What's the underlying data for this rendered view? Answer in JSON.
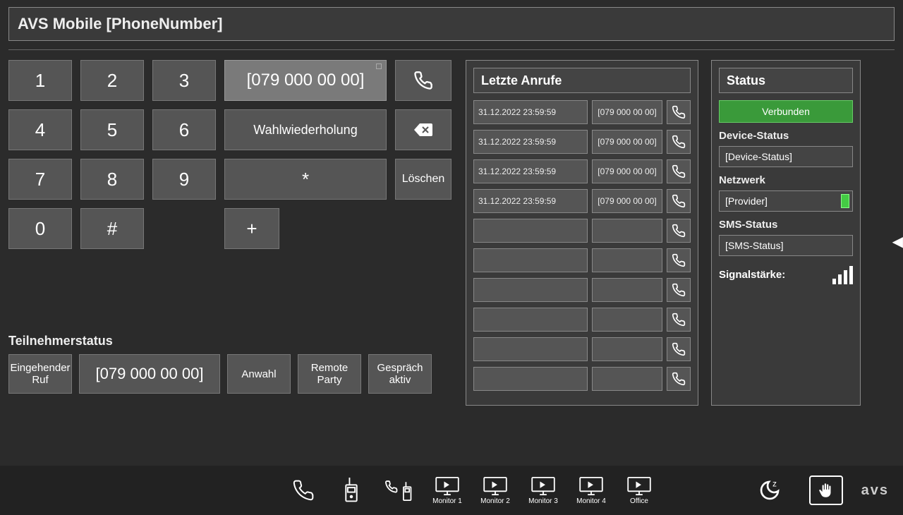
{
  "title": "AVS Mobile [PhoneNumber]",
  "dial": {
    "display": "[079 000 00 00]",
    "redial": "Wahlwiederholung",
    "clear": "Löschen",
    "keys": {
      "1": "1",
      "2": "2",
      "3": "3",
      "4": "4",
      "5": "5",
      "6": "6",
      "7": "7",
      "8": "8",
      "9": "9",
      "star": "*",
      "0": "0",
      "hash": "#",
      "plus": "+"
    }
  },
  "participant": {
    "label": "Teilnehmerstatus",
    "incoming": "Eingehender Ruf",
    "number": "[079 000 00 00]",
    "anwahl": "Anwahl",
    "remote": "Remote Party",
    "active": "Gespräch aktiv"
  },
  "recent": {
    "header": "Letzte Anrufe",
    "rows": [
      {
        "time": "31.12.2022 23:59:59",
        "num": "[079 000 00 00]"
      },
      {
        "time": "31.12.2022 23:59:59",
        "num": "[079 000 00 00]"
      },
      {
        "time": "31.12.2022 23:59:59",
        "num": "[079 000 00 00]"
      },
      {
        "time": "31.12.2022 23:59:59",
        "num": "[079 000 00 00]"
      },
      {
        "time": "",
        "num": ""
      },
      {
        "time": "",
        "num": ""
      },
      {
        "time": "",
        "num": ""
      },
      {
        "time": "",
        "num": ""
      },
      {
        "time": "",
        "num": ""
      },
      {
        "time": "",
        "num": ""
      }
    ]
  },
  "status": {
    "header": "Status",
    "connected": "Verbunden",
    "device_label": "Device-Status",
    "device_value": "[Device-Status]",
    "network_label": "Netzwerk",
    "network_value": "[Provider]",
    "sms_label": "SMS-Status",
    "sms_value": "[SMS-Status]",
    "signal_label": "Signalstärke:"
  },
  "bottom": {
    "monitors": [
      "Monitor 1",
      "Monitor 2",
      "Monitor 3",
      "Monitor 4",
      "Office"
    ]
  },
  "logo": "avs"
}
